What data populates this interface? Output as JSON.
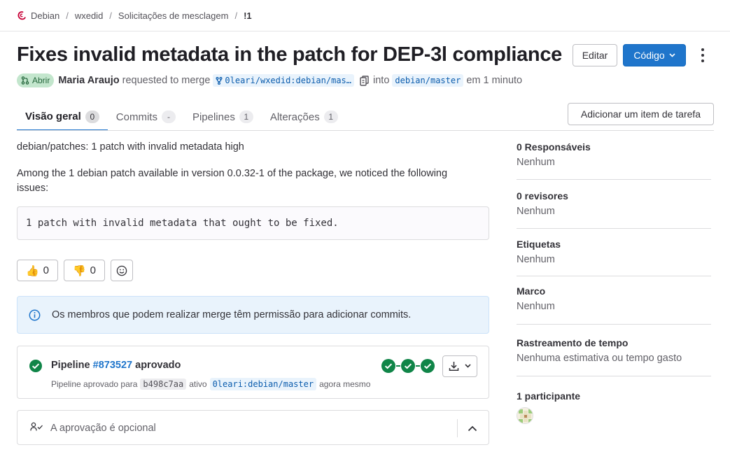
{
  "breadcrumb": {
    "items": [
      "Debian",
      "wxedid",
      "Solicitações de mesclagem",
      "!1"
    ]
  },
  "header": {
    "title": "Fixes invalid metadata in the patch for DEP-3l compliance",
    "edit_label": "Editar",
    "code_label": "Código"
  },
  "meta": {
    "status": "Abrir",
    "author": "Maria Araujo",
    "requested_text": "requested to merge",
    "source_branch": "0leari/wxedid:debian/mas…",
    "into_text": "into",
    "target_branch": "debian/master",
    "time_text": "em 1 minuto"
  },
  "tabs": [
    {
      "label": "Visão geral",
      "count": "0"
    },
    {
      "label": "Commits",
      "count": "-"
    },
    {
      "label": "Pipelines",
      "count": "1"
    },
    {
      "label": "Alterações",
      "count": "1"
    }
  ],
  "add_task_label": "Adicionar um item de tarefa",
  "description": {
    "line1": "debian/patches: 1 patch with invalid metadata high",
    "line2": "Among the 1 debian patch available in version 0.0.32-1 of the package, we noticed the following issues:",
    "code": "1 patch with invalid metadata that ought to be fixed."
  },
  "reactions": {
    "thumbs_up": "0",
    "thumbs_down": "0"
  },
  "alert": {
    "text": "Os membros que podem realizar merge têm permissão para adicionar commits."
  },
  "pipeline": {
    "label": "Pipeline",
    "id": "#873527",
    "status": "aprovado",
    "sub_prefix": "Pipeline aprovado para",
    "sha": "b498c7aa",
    "sub_mid": "ativo",
    "branch": "0leari:debian/master",
    "sub_time": "agora mesmo",
    "stages": [
      "passed",
      "passed",
      "passed"
    ]
  },
  "approval": {
    "text": "A aprovação é opcional"
  },
  "sidebar": {
    "assignees_title": "0 Responsáveis",
    "assignees_value": "Nenhum",
    "reviewers_title": "0 revisores",
    "reviewers_value": "Nenhum",
    "labels_title": "Etiquetas",
    "labels_value": "Nenhum",
    "milestone_title": "Marco",
    "milestone_value": "Nenhum",
    "time_title": "Rastreamento de tempo",
    "time_value": "Nenhuma estimativa ou tempo gasto",
    "participants_title": "1 participante"
  },
  "colors": {
    "primary": "#1f75cb",
    "success": "#108548",
    "open_badge_bg": "#c3e6cd",
    "info_bg": "#e9f3fc"
  }
}
